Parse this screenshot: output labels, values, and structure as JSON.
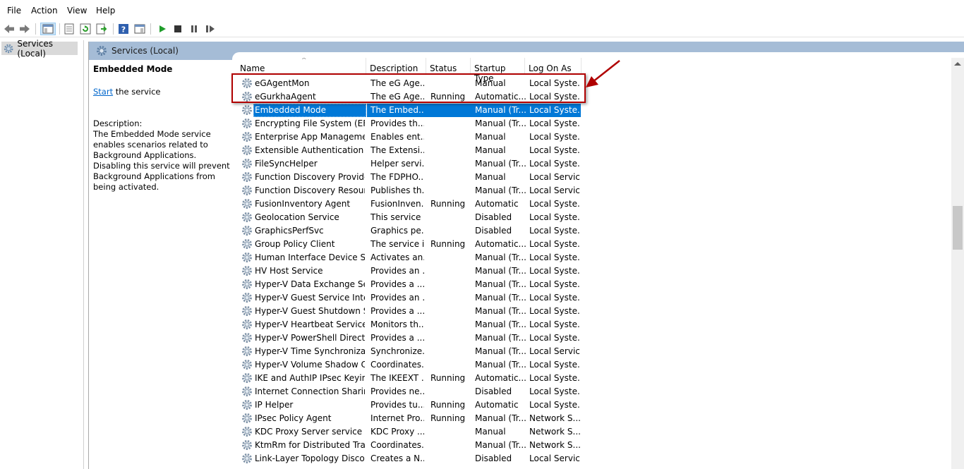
{
  "menu": [
    "File",
    "Action",
    "View",
    "Help"
  ],
  "tree": {
    "label": "Services (Local)"
  },
  "header": {
    "title": "Services (Local)"
  },
  "details": {
    "title": "Embedded Mode",
    "start_link": "Start",
    "start_rest": " the service",
    "description_label": "Description:",
    "description": "The Embedded Mode service enables scenarios related to Background Applications.  Disabling this service will prevent Background Applications from being activated."
  },
  "columns": [
    "Name",
    "Description",
    "Status",
    "Startup Type",
    "Log On As"
  ],
  "rows": [
    {
      "name": "eGAgentMon",
      "desc": "The eG Age...",
      "status": "",
      "startup": "Manual",
      "logon": "Local Syste..."
    },
    {
      "name": "eGurkhaAgent",
      "desc": "The eG Age...",
      "status": "Running",
      "startup": "Automatic...",
      "logon": "Local Syste..."
    },
    {
      "name": "Embedded Mode",
      "desc": "The Embed...",
      "status": "",
      "startup": "Manual (Tr...",
      "logon": "Local Syste..."
    },
    {
      "name": "Encrypting File System (EFS)",
      "desc": "Provides th...",
      "status": "",
      "startup": "Manual (Tr...",
      "logon": "Local Syste..."
    },
    {
      "name": "Enterprise App Managemen...",
      "desc": "Enables ent...",
      "status": "",
      "startup": "Manual",
      "logon": "Local Syste..."
    },
    {
      "name": "Extensible Authentication P...",
      "desc": "The Extensi...",
      "status": "",
      "startup": "Manual",
      "logon": "Local Syste..."
    },
    {
      "name": "FileSyncHelper",
      "desc": "Helper servi...",
      "status": "",
      "startup": "Manual (Tr...",
      "logon": "Local Syste..."
    },
    {
      "name": "Function Discovery Provide...",
      "desc": "The FDPHO...",
      "status": "",
      "startup": "Manual",
      "logon": "Local Service"
    },
    {
      "name": "Function Discovery Resourc...",
      "desc": "Publishes th...",
      "status": "",
      "startup": "Manual (Tr...",
      "logon": "Local Service"
    },
    {
      "name": "FusionInventory Agent",
      "desc": "FusionInven...",
      "status": "Running",
      "startup": "Automatic",
      "logon": "Local Syste..."
    },
    {
      "name": "Geolocation Service",
      "desc": "This service ...",
      "status": "",
      "startup": "Disabled",
      "logon": "Local Syste..."
    },
    {
      "name": "GraphicsPerfSvc",
      "desc": "Graphics pe...",
      "status": "",
      "startup": "Disabled",
      "logon": "Local Syste..."
    },
    {
      "name": "Group Policy Client",
      "desc": "The service i...",
      "status": "Running",
      "startup": "Automatic...",
      "logon": "Local Syste..."
    },
    {
      "name": "Human Interface Device Ser...",
      "desc": "Activates an...",
      "status": "",
      "startup": "Manual (Tr...",
      "logon": "Local Syste..."
    },
    {
      "name": "HV Host Service",
      "desc": "Provides an ...",
      "status": "",
      "startup": "Manual (Tr...",
      "logon": "Local Syste..."
    },
    {
      "name": "Hyper-V Data Exchange Ser...",
      "desc": "Provides a ...",
      "status": "",
      "startup": "Manual (Tr...",
      "logon": "Local Syste..."
    },
    {
      "name": "Hyper-V Guest Service Inter...",
      "desc": "Provides an ...",
      "status": "",
      "startup": "Manual (Tr...",
      "logon": "Local Syste..."
    },
    {
      "name": "Hyper-V Guest Shutdown S...",
      "desc": "Provides a ...",
      "status": "",
      "startup": "Manual (Tr...",
      "logon": "Local Syste..."
    },
    {
      "name": "Hyper-V Heartbeat Service",
      "desc": "Monitors th...",
      "status": "",
      "startup": "Manual (Tr...",
      "logon": "Local Syste..."
    },
    {
      "name": "Hyper-V PowerShell Direct ...",
      "desc": "Provides a ...",
      "status": "",
      "startup": "Manual (Tr...",
      "logon": "Local Syste..."
    },
    {
      "name": "Hyper-V Time Synchronizati...",
      "desc": "Synchronize...",
      "status": "",
      "startup": "Manual (Tr...",
      "logon": "Local Service"
    },
    {
      "name": "Hyper-V Volume Shadow C...",
      "desc": "Coordinates...",
      "status": "",
      "startup": "Manual (Tr...",
      "logon": "Local Syste..."
    },
    {
      "name": "IKE and AuthIP IPsec Keying...",
      "desc": "The IKEEXT ...",
      "status": "Running",
      "startup": "Automatic...",
      "logon": "Local Syste..."
    },
    {
      "name": "Internet Connection Sharin...",
      "desc": "Provides ne...",
      "status": "",
      "startup": "Disabled",
      "logon": "Local Syste..."
    },
    {
      "name": "IP Helper",
      "desc": "Provides tu...",
      "status": "Running",
      "startup": "Automatic",
      "logon": "Local Syste..."
    },
    {
      "name": "IPsec Policy Agent",
      "desc": "Internet Pro...",
      "status": "Running",
      "startup": "Manual (Tr...",
      "logon": "Network S..."
    },
    {
      "name": "KDC Proxy Server service (K...",
      "desc": "KDC Proxy ...",
      "status": "",
      "startup": "Manual",
      "logon": "Network S..."
    },
    {
      "name": "KtmRm for Distributed Tran...",
      "desc": "Coordinates...",
      "status": "",
      "startup": "Manual (Tr...",
      "logon": "Network S..."
    },
    {
      "name": "Link-Layer Topology Discov...",
      "desc": "Creates a N...",
      "status": "",
      "startup": "Disabled",
      "logon": "Local Service"
    }
  ],
  "selected_row": "Embedded Mode",
  "colors": {
    "selection": "#0078d7",
    "header_band": "#a5bcd6",
    "annotation": "#b00000"
  }
}
